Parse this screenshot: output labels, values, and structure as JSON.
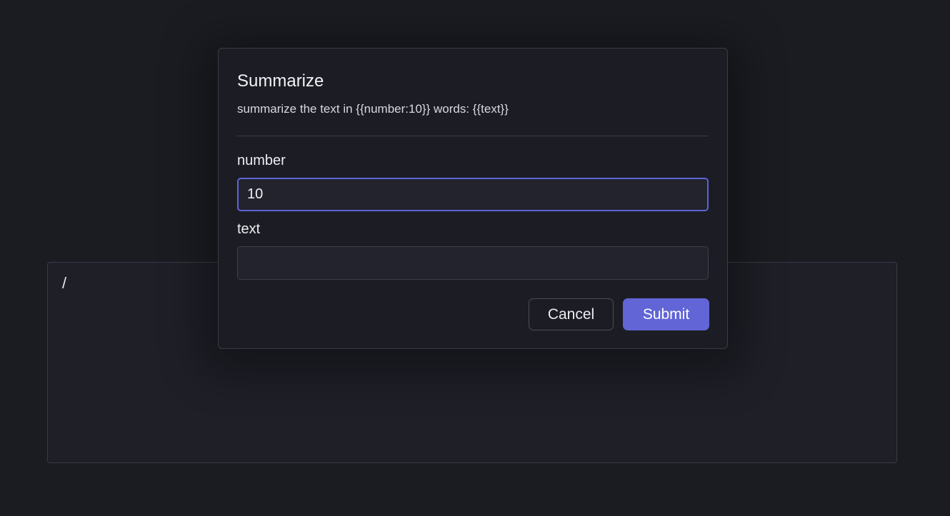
{
  "editor": {
    "content": "/"
  },
  "dialog": {
    "title": "Summarize",
    "template": "summarize the text in {{number:10}} words: {{text}}",
    "fields": [
      {
        "label": "number",
        "value": "10",
        "placeholder": ""
      },
      {
        "label": "text",
        "value": "",
        "placeholder": ""
      }
    ],
    "cancel_label": "Cancel",
    "submit_label": "Submit"
  },
  "colors": {
    "background": "#1b1c22",
    "accent": "#6165d6",
    "focus_border": "#5f64d8"
  }
}
